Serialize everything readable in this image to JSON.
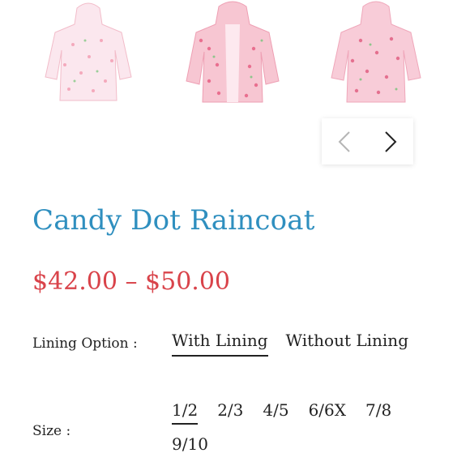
{
  "gallery": {
    "images": [
      {
        "alt": "raincoat-front-light"
      },
      {
        "alt": "raincoat-open"
      },
      {
        "alt": "raincoat-front"
      }
    ],
    "prev_icon": "chevron-left-icon",
    "next_icon": "chevron-right-icon"
  },
  "product": {
    "title": "Candy Dot Raincoat",
    "price_range": "$42.00 – $50.00"
  },
  "lining": {
    "label": "Lining Option :",
    "options": [
      "With Lining",
      "Without Lining"
    ],
    "selected": "With Lining"
  },
  "size": {
    "label": "Size :",
    "options": [
      "1/2",
      "2/3",
      "4/5",
      "6/6X",
      "7/8",
      "9/10"
    ],
    "selected": "1/2"
  },
  "colors": {
    "title": "#2f8fbf",
    "price": "#d9434a",
    "coat_pink": "#f7c6d2",
    "coat_light": "#fbe3ea"
  }
}
